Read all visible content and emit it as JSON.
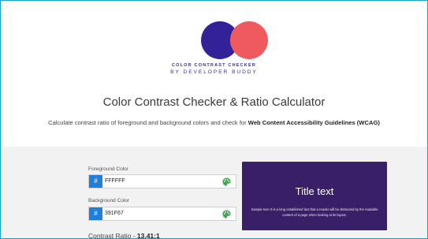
{
  "logo": {
    "line1": "COLOR CONTRAST CHECKER",
    "line2": "BY DEVELOPER BUDDY",
    "circle_left_color": "#33219a",
    "circle_right_color": "#ef5a5f"
  },
  "header": {
    "title": "Color Contrast Checker & Ratio Calculator",
    "subtitle_prefix": "Calculate contrast ratio of foreground and background colors and check for ",
    "subtitle_bold": "Web Content Accessibility Guidelines (WCAG)"
  },
  "foreground": {
    "label": "Foreground Color",
    "hash": "#",
    "value": "FFFFFF",
    "icon": "palette-icon"
  },
  "background": {
    "label": "Background Color",
    "hash": "#",
    "value": "391F67",
    "icon": "palette-icon"
  },
  "contrast": {
    "label": "Contrast Ratio - ",
    "value": "13.41:1"
  },
  "preview": {
    "title": "Title text",
    "sample": "Sample text: It is a long established fact that a reader will be distracted by the readable content of a page when looking at its layout.",
    "bg_color": "#391F67",
    "fg_color": "#FFFFFF"
  },
  "colors": {
    "accent": "#1f7fd9",
    "frame_border": "#16a3c8",
    "palette_green": "#3aa64a"
  }
}
